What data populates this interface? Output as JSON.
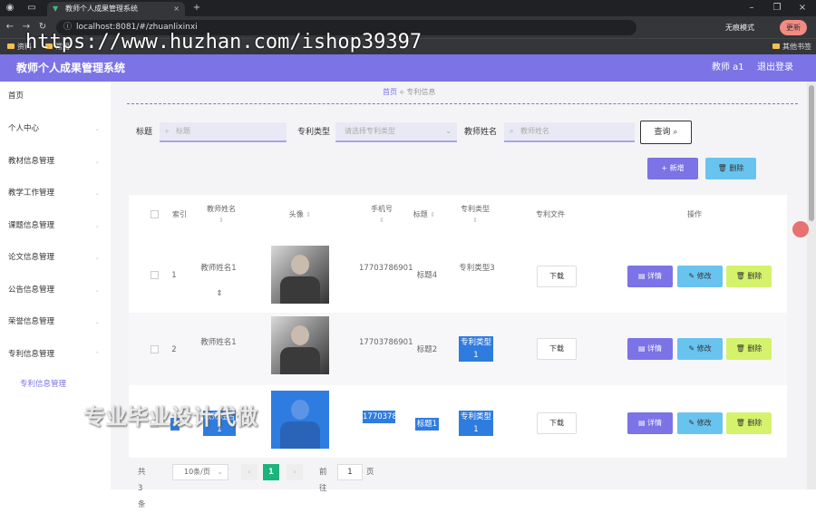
{
  "browser": {
    "tab_title": "教师个人成果管理系统",
    "url": "localhost:8081/#/zhuanlixinxi",
    "incognito_label": "无痕模式",
    "update_label": "更新",
    "bookmarks": [
      "资料",
      "常用"
    ],
    "other_bookmarks": "其他书签"
  },
  "watermark": "https://www.huzhan.com/ishop39397",
  "overlay_text": "专业毕业设计代做",
  "app": {
    "title": "教师个人成果管理系统",
    "user": "教师 a1",
    "logout": "退出登录"
  },
  "sidebar": {
    "items": [
      {
        "label": "首页"
      },
      {
        "label": "个人中心"
      },
      {
        "label": "教材信息管理"
      },
      {
        "label": "教学工作管理"
      },
      {
        "label": "课题信息管理"
      },
      {
        "label": "论文信息管理"
      },
      {
        "label": "公告信息管理"
      },
      {
        "label": "荣誉信息管理"
      },
      {
        "label": "专利信息管理"
      }
    ],
    "sub_item": "专利信息管理"
  },
  "breadcrumb": {
    "home": "首页",
    "current": "专利信息"
  },
  "search": {
    "title_label": "标题",
    "title_placeholder": "标题",
    "type_label": "专利类型",
    "type_placeholder": "请选择专利类型",
    "teacher_label": "教师姓名",
    "teacher_placeholder": "教师姓名",
    "query_button": "查询"
  },
  "actions": {
    "add": "新增",
    "delete": "删除"
  },
  "table": {
    "headers": [
      "索引",
      "教师姓名",
      "头像",
      "手机号",
      "标题",
      "专利类型",
      "专利文件",
      "操作"
    ],
    "rows": [
      {
        "index": "1",
        "teacher": "教师姓名1",
        "phone": "17703786901",
        "title": "标题4",
        "type": "专利类型3",
        "file": "下载"
      },
      {
        "index": "2",
        "teacher": "教师姓名1",
        "phone": "17703786901",
        "title": "标题2",
        "type": "专利类型1",
        "file": "下载"
      },
      {
        "index": "3",
        "teacher": "教师姓名1",
        "phone": "17703786901",
        "title": "标题1",
        "type": "专利类型1",
        "file": "下载"
      }
    ],
    "op_labels": {
      "detail": "详情",
      "edit": "修改",
      "delete": "删除"
    }
  },
  "pager": {
    "total": "共 3 条",
    "page_size": "10条/页",
    "current": "1",
    "goto_label": "前往",
    "goto_value": "1",
    "page_suffix": "页"
  },
  "colors": {
    "accent": "#7b73e6",
    "info": "#69c3ef",
    "warn": "#d4f26b",
    "current_page": "#1bb47c"
  }
}
